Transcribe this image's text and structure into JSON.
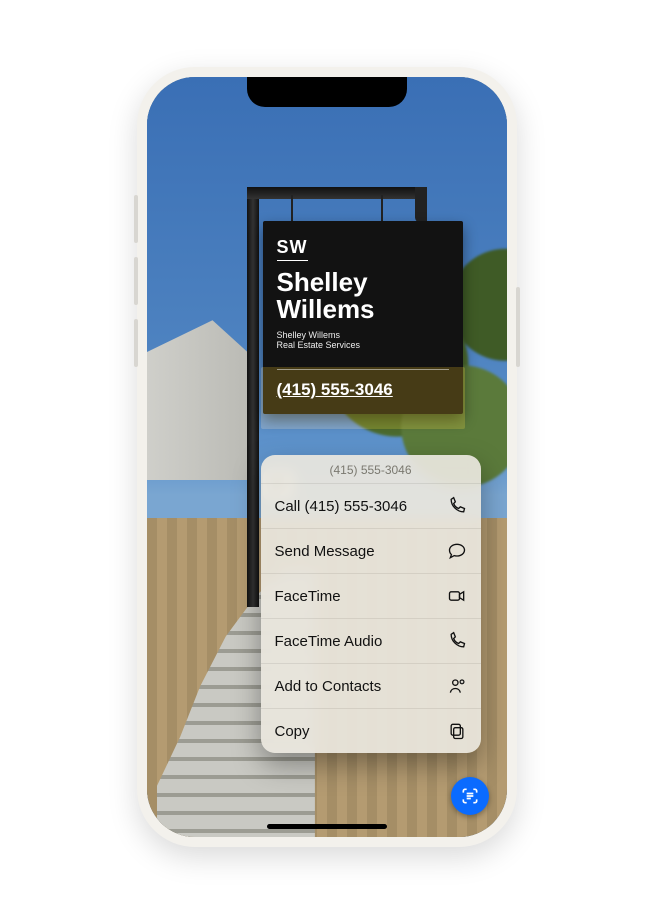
{
  "sign": {
    "logo": "SW",
    "name_line1": "Shelley",
    "name_line2": "Willems",
    "sub_line1": "Shelley Willems",
    "sub_line2": "Real Estate Services",
    "phone": "(415) 555-3046"
  },
  "menu": {
    "title": "(415) 555-3046",
    "items": [
      {
        "label": "Call (415) 555-3046",
        "icon": "phone-icon"
      },
      {
        "label": "Send Message",
        "icon": "message-icon"
      },
      {
        "label": "FaceTime",
        "icon": "video-icon"
      },
      {
        "label": "FaceTime Audio",
        "icon": "phone-icon"
      },
      {
        "label": "Add to Contacts",
        "icon": "add-contact-icon"
      },
      {
        "label": "Copy",
        "icon": "copy-icon"
      }
    ]
  }
}
